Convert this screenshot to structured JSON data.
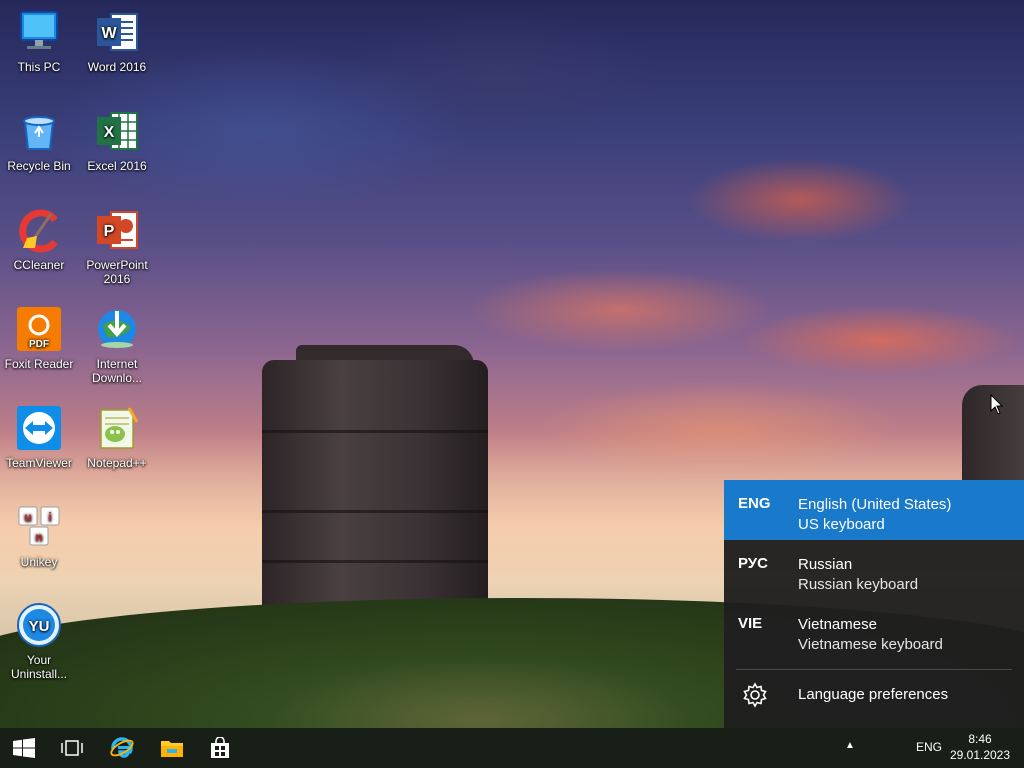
{
  "desktop_icons": [
    {
      "label": "This PC",
      "icon": "this-pc-icon"
    },
    {
      "label": "Word 2016",
      "icon": "word-icon"
    },
    {
      "label": "Recycle Bin",
      "icon": "recycle-bin-icon"
    },
    {
      "label": "Excel 2016",
      "icon": "excel-icon"
    },
    {
      "label": "CCleaner",
      "icon": "ccleaner-icon"
    },
    {
      "label": "PowerPoint 2016",
      "icon": "powerpoint-icon"
    },
    {
      "label": "Foxit Reader",
      "icon": "foxit-reader-icon"
    },
    {
      "label": "Internet Downlo...",
      "icon": "internet-download-manager-icon"
    },
    {
      "label": "TeamViewer",
      "icon": "teamviewer-icon"
    },
    {
      "label": "Notepad++",
      "icon": "notepad-plus-plus-icon"
    },
    {
      "label": "Unikey",
      "icon": "unikey-icon"
    },
    {
      "label": "Your Uninstall...",
      "icon": "your-uninstaller-icon"
    }
  ],
  "icon_glyphs": {
    "word": "W",
    "excel": "X",
    "powerpoint": "P",
    "foxit": "PDF",
    "unikey": [
      "u",
      "i",
      "n"
    ],
    "your_uninstaller": "YU"
  },
  "language_flyout": {
    "items": [
      {
        "code": "ENG",
        "name": "English (United States)",
        "keyboard": "US keyboard",
        "selected": true
      },
      {
        "code": "РУС",
        "name": "Russian",
        "keyboard": "Russian keyboard",
        "selected": false
      },
      {
        "code": "VIE",
        "name": "Vietnamese",
        "keyboard": "Vietnamese keyboard",
        "selected": false
      }
    ],
    "preferences_label": "Language preferences",
    "accent_color": "#1979ca"
  },
  "taskbar": {
    "pinned": [
      "start-button",
      "task-view-button",
      "internet-explorer",
      "file-explorer",
      "store"
    ],
    "tray_chevron": "▲",
    "language_indicator": "ENG",
    "clock_time": "8:46",
    "clock_date": "29.01.2023"
  }
}
